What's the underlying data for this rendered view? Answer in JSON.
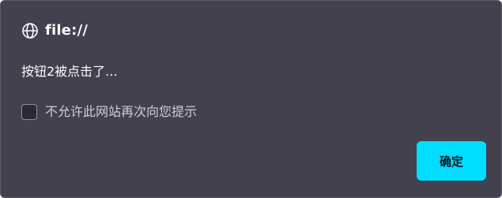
{
  "dialog": {
    "title": "file://",
    "title_icon": "globe-icon",
    "message": "按钮2被点击了...",
    "checkbox_label": "不允许此网站再次向您提示",
    "checkbox_checked": false,
    "ok_label": "确定"
  },
  "colors": {
    "background": "#42414d",
    "text": "#fbfbfe",
    "accent": "#00ddff",
    "button_text": "#15141a"
  }
}
